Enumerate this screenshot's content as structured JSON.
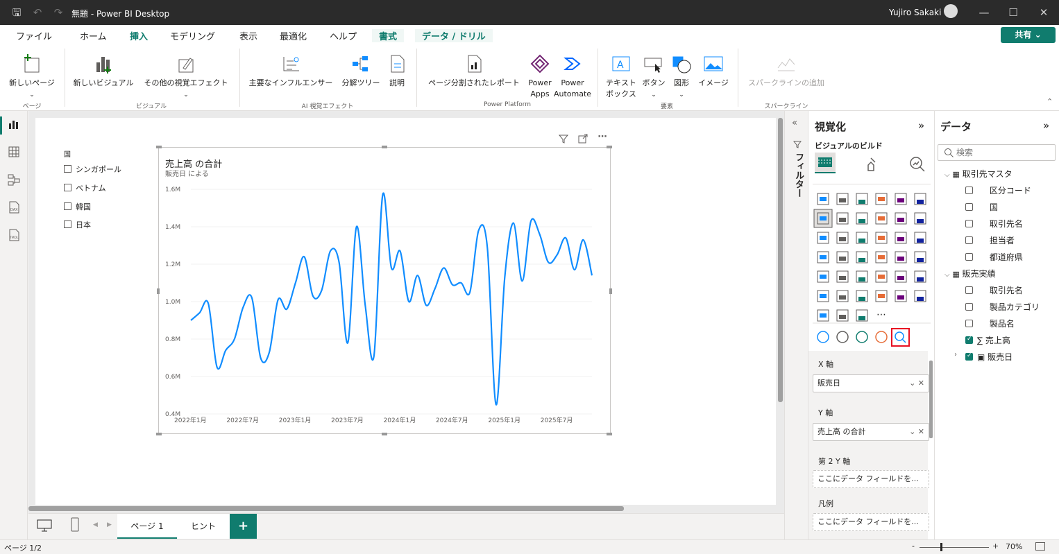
{
  "titlebar": {
    "title": "無題 - Power BI Desktop",
    "user": "Yujiro Sakaki"
  },
  "tabs": [
    "ファイル",
    "ホーム",
    "挿入",
    "モデリング",
    "表示",
    "最適化",
    "ヘルプ",
    "書式",
    "データ / ドリル"
  ],
  "share_label": "共有",
  "ribbon": {
    "new_page": "新しいページ",
    "grp_page": "ページ",
    "new_visual": "新しいビジュアル",
    "other_visuals": "その他の視覚エフェクト",
    "grp_visual": "ビジュアル",
    "key_influencers": "主要なインフルエンサー",
    "decomp_tree": "分解ツリー",
    "narrative": "説明",
    "grp_ai": "AI 視覚エフェクト",
    "paginated": "ページ分割されたレポート",
    "power_apps_1": "Power",
    "power_apps_2": "Apps",
    "power_automate_1": "Power",
    "power_automate_2": "Automate",
    "grp_pp": "Power Platform",
    "textbox_1": "テキスト",
    "textbox_2": "ボックス",
    "buttons": "ボタン",
    "shapes": "図形",
    "image": "イメージ",
    "grp_elements": "要素",
    "sparkline": "スパークラインの追加",
    "grp_sparkline": "スパークライン"
  },
  "slicer": {
    "title": "国",
    "items": [
      "シンガポール",
      "ベトナム",
      "韓国",
      "日本"
    ]
  },
  "chart_data": {
    "type": "line",
    "title": "売上高 の合計",
    "subtitle": "販売日 による",
    "ylim": [
      0.4,
      1.6
    ],
    "yticks": [
      "1.6M",
      "1.4M",
      "1.2M",
      "1.0M",
      "0.8M",
      "0.6M",
      "0.4M"
    ],
    "xticks": [
      "2022年1月",
      "2022年7月",
      "2023年1月",
      "2023年7月",
      "2024年1月",
      "2024年7月",
      "2025年1月",
      "2025年7月"
    ],
    "series": [
      {
        "color": "#118dff",
        "values": [
          0.9,
          0.94,
          0.99,
          0.65,
          0.74,
          0.8,
          0.97,
          1.02,
          0.7,
          0.73,
          1.01,
          0.96,
          1.1,
          1.24,
          1.03,
          1.06,
          1.27,
          1.21,
          0.78,
          1.4,
          0.98,
          0.71,
          1.57,
          1.18,
          1.27,
          1.0,
          1.14,
          0.98,
          1.07,
          1.18,
          1.09,
          1.1,
          1.05,
          1.38,
          1.29,
          0.45,
          1.13,
          1.42,
          1.11,
          1.43,
          1.36,
          1.21,
          1.25,
          1.34,
          1.17,
          1.33,
          1.14
        ]
      }
    ]
  },
  "filters_label": "フィルター",
  "viz": {
    "title": "視覚化",
    "build": "ビジュアルのビルド",
    "wells": [
      {
        "label": "X 軸",
        "value": "販売日"
      },
      {
        "label": "Y 軸",
        "value": "売上高 の合計"
      },
      {
        "label": "第 2 Y 軸",
        "value": "ここにデータ フィールドを..."
      },
      {
        "label": "凡例",
        "value": "ここにデータ フィールドを..."
      }
    ]
  },
  "data": {
    "title": "データ",
    "search_placeholder": "検索",
    "tables": [
      {
        "name": "取引先マスタ",
        "fields": [
          "区分コード",
          "国",
          "取引先名",
          "担当者",
          "都道府県"
        ]
      },
      {
        "name": "販売実績",
        "fields": [
          "取引先名",
          "製品カテゴリ",
          "製品名",
          "売上高",
          "販売日"
        ]
      }
    ]
  },
  "pages": {
    "page1": "ページ 1",
    "hint": "ヒント"
  },
  "status": {
    "page": "ページ 1/2",
    "zoom": "70%"
  }
}
